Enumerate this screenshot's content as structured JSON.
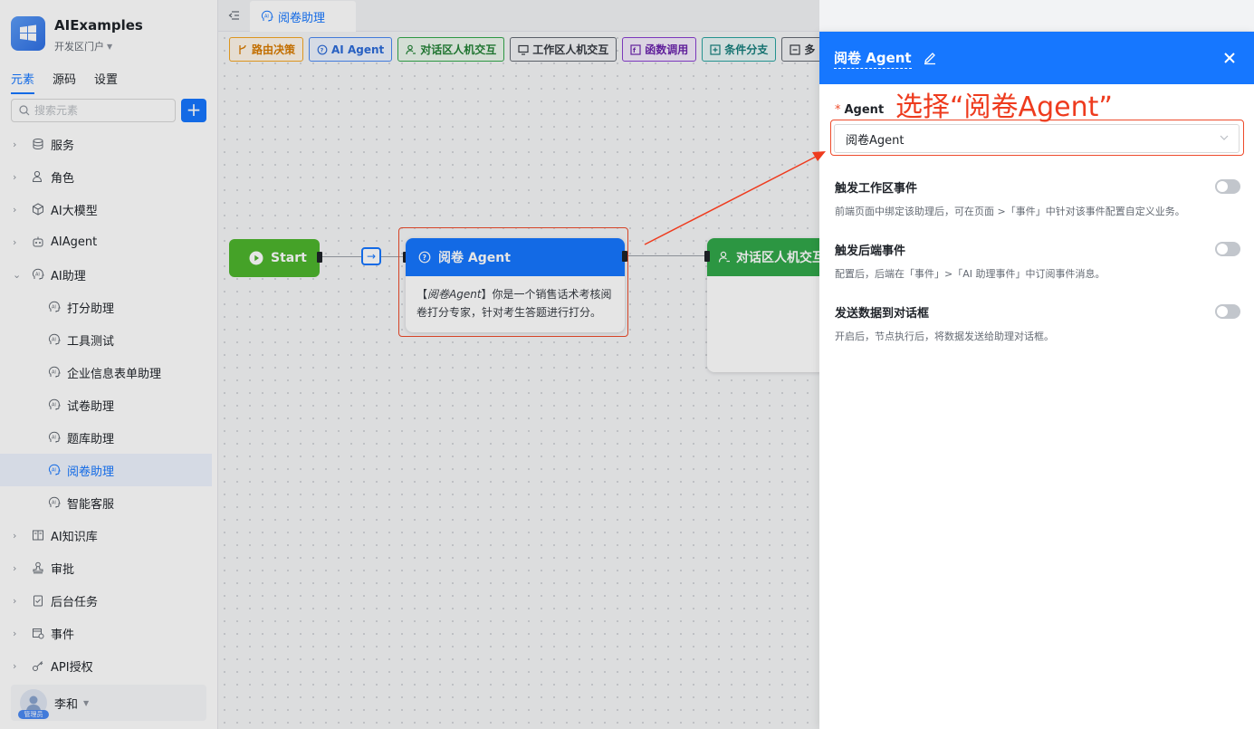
{
  "app": {
    "name": "AIExamples",
    "portal": "开发区门户"
  },
  "sidebar": {
    "tabs": [
      "元素",
      "源码",
      "设置"
    ],
    "search_placeholder": "搜索元素",
    "add_label": "+",
    "items": [
      {
        "label": "服务",
        "icon": "service-icon"
      },
      {
        "label": "角色",
        "icon": "role-icon"
      },
      {
        "label": "AI大模型",
        "icon": "model-icon"
      },
      {
        "label": "AIAgent",
        "icon": "robot-icon"
      },
      {
        "label": "AI助理",
        "icon": "ai-assistant-icon"
      },
      {
        "label": "打分助理",
        "icon": "ai-assistant-icon"
      },
      {
        "label": "工具测试",
        "icon": "ai-assistant-icon"
      },
      {
        "label": "企业信息表单助理",
        "icon": "ai-assistant-icon"
      },
      {
        "label": "试卷助理",
        "icon": "ai-assistant-icon"
      },
      {
        "label": "题库助理",
        "icon": "ai-assistant-icon"
      },
      {
        "label": "阅卷助理",
        "icon": "ai-assistant-icon"
      },
      {
        "label": "智能客服",
        "icon": "ai-assistant-icon"
      },
      {
        "label": "AI知识库",
        "icon": "knowledge-icon"
      },
      {
        "label": "审批",
        "icon": "approval-icon"
      },
      {
        "label": "后台任务",
        "icon": "task-icon"
      },
      {
        "label": "事件",
        "icon": "event-icon"
      },
      {
        "label": "API授权",
        "icon": "key-icon"
      }
    ],
    "user": {
      "name": "李和",
      "role": "管理员"
    }
  },
  "tabbar": {
    "active_tab": "阅卷助理"
  },
  "canvas": {
    "toolbar": [
      "路由决策",
      "AI Agent",
      "对话区人机交互",
      "工作区人机交互",
      "函数调用",
      "条件分支",
      "多"
    ],
    "start_label": "Start",
    "agent_node": {
      "title": "阅卷 Agent",
      "desc_prefix": "【",
      "desc_name": "阅卷Agent",
      "desc_rest": "】你是一个销售话术考核阅卷打分专家，针对考生答题进行打分。"
    },
    "chat_node": {
      "title": "对话区人机交互"
    }
  },
  "drawer": {
    "title": "阅卷 Agent",
    "agent_label": "Agent",
    "annotation": "选择“阅卷Agent”",
    "agent_value": "阅卷Agent",
    "settings": [
      {
        "title": "触发工作区事件",
        "desc": "前端页面中绑定该助理后，可在页面 >「事件」中针对该事件配置自定义业务。"
      },
      {
        "title": "触发后端事件",
        "desc": "配置后，后端在「事件」>「AI 助理事件」中订阅事件消息。"
      },
      {
        "title": "发送数据到对话框",
        "desc": "开启后，节点执行后，将数据发送给助理对话框。"
      }
    ]
  },
  "colors": {
    "primary": "#1677ff",
    "start_green": "#4db52d",
    "chat_green": "#31a84a",
    "annotation_red": "#ee3b1e"
  }
}
